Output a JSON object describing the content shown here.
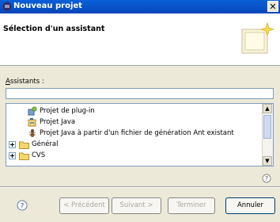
{
  "window": {
    "title": "Nouveau projet"
  },
  "banner": {
    "title": "Sélection d'un assistant"
  },
  "filter": {
    "label": "Assistants :",
    "value": ""
  },
  "tree": {
    "items": [
      {
        "label": "Projet de plug-in",
        "icon": "plugin-project-icon"
      },
      {
        "label": "Projet Java",
        "icon": "java-project-icon"
      },
      {
        "label": "Projet Java à partir d'un fichier de génération Ant existant",
        "icon": "ant-project-icon"
      },
      {
        "label": "Général",
        "icon": "folder-icon",
        "expander": "+"
      },
      {
        "label": "CVS",
        "icon": "folder-icon",
        "expander": "+"
      }
    ]
  },
  "buttons": {
    "prev": "< Précédent",
    "next": "Suivant >",
    "finish": "Terminer",
    "cancel": "Annuler"
  }
}
